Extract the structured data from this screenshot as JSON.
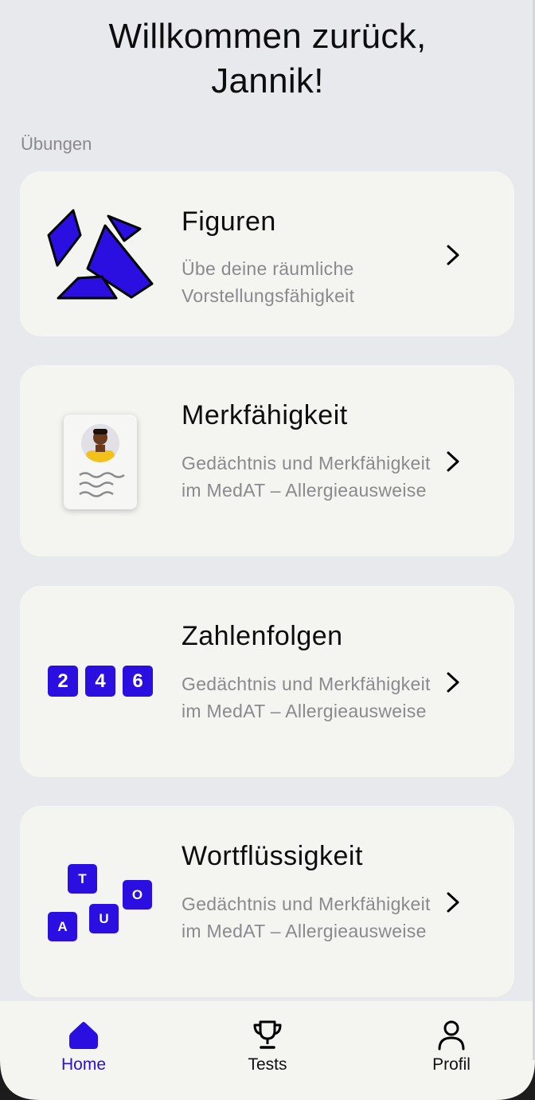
{
  "header": {
    "title_line1": "Willkommen zurück,",
    "title_line2": "Jannik!"
  },
  "section_label": "Übungen",
  "colors": {
    "accent": "#2b0fe0",
    "card_background": "#f4f4f1",
    "page_background": "#e8e9ed",
    "muted_text": "#8a8a8e"
  },
  "exercises": [
    {
      "title": "Figuren",
      "description": "Übe deine räumliche Vorstellungsfähigkeit",
      "icon": "shape-pieces-icon"
    },
    {
      "title": "Merkfähigkeit",
      "description": "Gedächtnis und Merkfähigkeit im MedAT – Allergieausweise",
      "icon": "id-card-icon"
    },
    {
      "title": "Zahlenfolgen",
      "description": "Gedächtnis und Merkfähigkeit im MedAT – Allergieausweise",
      "icon": "number-tiles-icon",
      "tiles": [
        "2",
        "4",
        "6"
      ]
    },
    {
      "title": "Wortflüssigkeit",
      "description": "Gedächtnis und Merkfähigkeit im MedAT – Allergieausweise",
      "icon": "letter-tiles-icon",
      "tiles": [
        "T",
        "O",
        "U",
        "A"
      ]
    }
  ],
  "nav": [
    {
      "label": "Home",
      "icon": "home-icon",
      "active": true
    },
    {
      "label": "Tests",
      "icon": "trophy-icon",
      "active": false
    },
    {
      "label": "Profil",
      "icon": "user-icon",
      "active": false
    }
  ]
}
